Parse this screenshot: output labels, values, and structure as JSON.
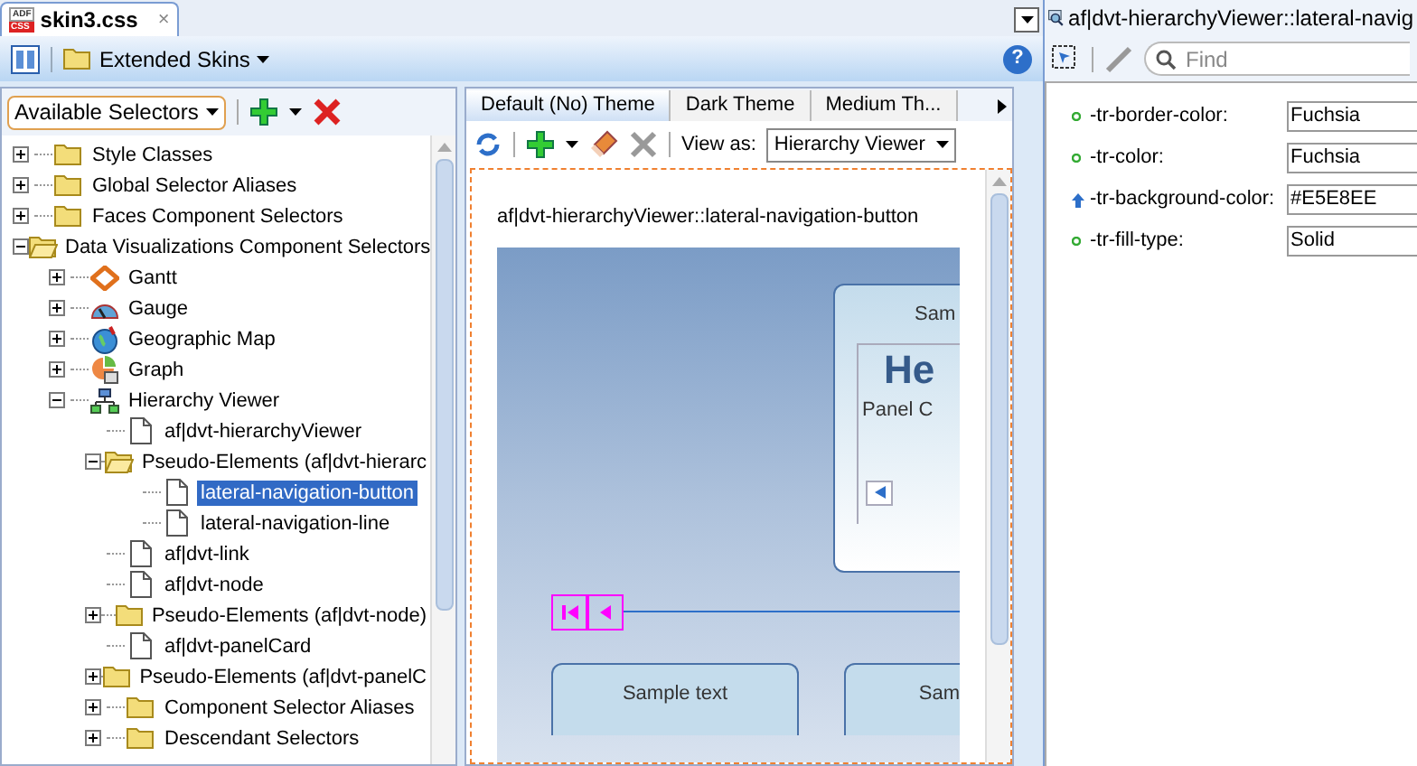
{
  "editor_tab": {
    "icon_text_top": "ADF",
    "icon_text_bottom": "CSS",
    "title": "skin3.css",
    "close": "×"
  },
  "toolbar": {
    "skins_label": "Extended Skins",
    "help": "?"
  },
  "selectors": {
    "dropdown": "Available Selectors"
  },
  "tree": [
    {
      "label": "Style Classes",
      "kind": "folder",
      "expanded": false,
      "selected": false
    },
    {
      "label": "Global Selector Aliases",
      "kind": "folder",
      "expanded": false,
      "selected": false
    },
    {
      "label": "Faces Component Selectors",
      "kind": "folder",
      "expanded": false,
      "selected": false
    },
    {
      "label": "Data Visualizations Component Selectors",
      "kind": "folder",
      "expanded": true,
      "selected": false,
      "children": [
        {
          "label": "Gantt",
          "kind": "gantt",
          "expanded": false,
          "selected": false
        },
        {
          "label": "Gauge",
          "kind": "gauge",
          "expanded": false,
          "selected": false
        },
        {
          "label": "Geographic Map",
          "kind": "map",
          "expanded": false,
          "selected": false
        },
        {
          "label": "Graph",
          "kind": "graph",
          "expanded": false,
          "selected": false
        },
        {
          "label": "Hierarchy Viewer",
          "kind": "hierarchy",
          "expanded": true,
          "selected": false,
          "children": [
            {
              "label": "af|dvt-hierarchyViewer",
              "kind": "file",
              "selected": false
            },
            {
              "label": "Pseudo-Elements (af|dvt-hierarc",
              "kind": "folder",
              "expanded": true,
              "selected": false,
              "children": [
                {
                  "label": "lateral-navigation-button",
                  "kind": "file",
                  "selected": true
                },
                {
                  "label": "lateral-navigation-line",
                  "kind": "file",
                  "selected": false
                }
              ]
            },
            {
              "label": "af|dvt-link",
              "kind": "file",
              "selected": false
            },
            {
              "label": "af|dvt-node",
              "kind": "file",
              "selected": false
            },
            {
              "label": "Pseudo-Elements (af|dvt-node)",
              "kind": "folder",
              "expanded": false,
              "selected": false
            },
            {
              "label": "af|dvt-panelCard",
              "kind": "file",
              "selected": false
            },
            {
              "label": "Pseudo-Elements (af|dvt-panelC",
              "kind": "folder",
              "expanded": false,
              "selected": false
            },
            {
              "label": "Component Selector Aliases",
              "kind": "folder",
              "expanded": false,
              "selected": false
            },
            {
              "label": "Descendant Selectors",
              "kind": "folder",
              "expanded": false,
              "selected": false
            }
          ]
        }
      ]
    }
  ],
  "theme_tabs": [
    {
      "label": "Default (No) Theme",
      "selected": true
    },
    {
      "label": "Dark Theme",
      "selected": false
    },
    {
      "label": "Medium Th...",
      "selected": false
    }
  ],
  "preview_toolbar": {
    "view_as_label": "View as:",
    "view_as_value": "Hierarchy Viewer"
  },
  "preview": {
    "selector": "af|dvt-hierarchyViewer::lateral-navigation-button",
    "card_top_text": "Sam",
    "card_title": "He",
    "card_subtitle": "Panel C",
    "node_left_text": "Sample text",
    "node_right_text": "Sam"
  },
  "inspector": {
    "title": "af|dvt-hierarchyViewer::lateral-navig",
    "search_placeholder": "Find",
    "properties": [
      {
        "name": "-tr-border-color:",
        "value": "Fuchsia",
        "kind": "set"
      },
      {
        "name": "-tr-color:",
        "value": "Fuchsia",
        "kind": "set"
      },
      {
        "name": "-tr-background-color:",
        "value": "#E5E8EE",
        "kind": "inherited"
      },
      {
        "name": "-tr-fill-type:",
        "value": "Solid",
        "kind": "set"
      }
    ]
  }
}
